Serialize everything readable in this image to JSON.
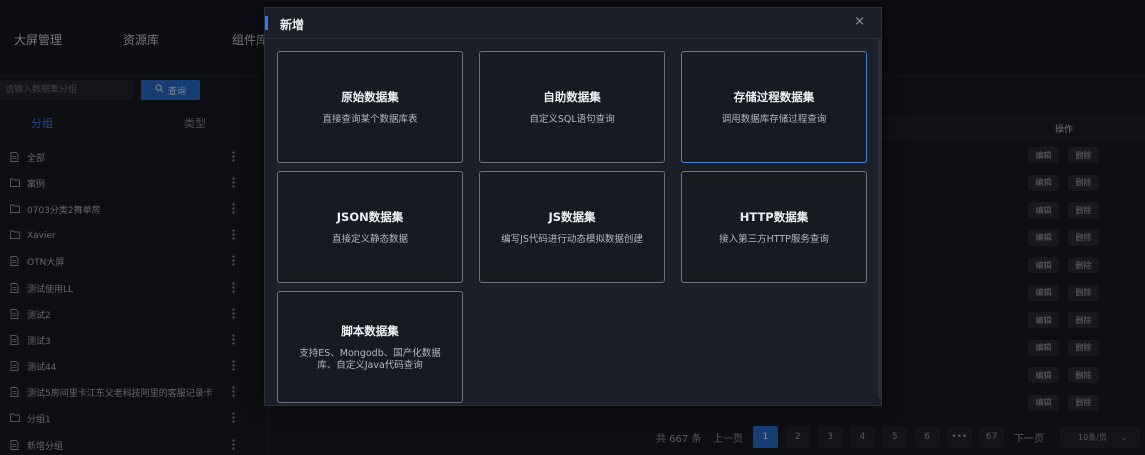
{
  "nav": [
    "大屏管理",
    "资源库",
    "组件库"
  ],
  "search": {
    "placeholder": "请输入数据集分组",
    "button": "查询"
  },
  "tabs": {
    "group": "分组",
    "type": "类型"
  },
  "tree": [
    {
      "label": "全部",
      "icon": "file-icon"
    },
    {
      "label": "案例",
      "icon": "folder-icon"
    },
    {
      "label": "0703分类2舞单房",
      "icon": "folder-icon"
    },
    {
      "label": "Xavier",
      "icon": "folder-icon"
    },
    {
      "label": "OTN大屏",
      "icon": "file-icon"
    },
    {
      "label": "测试使用LL",
      "icon": "file-icon"
    },
    {
      "label": "测试2",
      "icon": "file-icon"
    },
    {
      "label": "测试3",
      "icon": "file-icon"
    },
    {
      "label": "测试44",
      "icon": "file-icon"
    },
    {
      "label": "测试5房间里卡江东父老科技阿里的客服记录卡",
      "icon": "file-icon"
    },
    {
      "label": "分组1",
      "icon": "folder-icon"
    },
    {
      "label": "新增分组",
      "icon": "file-icon"
    }
  ],
  "table": {
    "op_header": "操作",
    "edit": "编辑",
    "delete": "删除",
    "row_count": 10
  },
  "pager": {
    "total": "共 667 条",
    "prev": "上一页",
    "next": "下一页",
    "pages": [
      "1",
      "2",
      "3",
      "4",
      "5",
      "6",
      "•••",
      "67"
    ],
    "current": "1",
    "page_size": "10条/页"
  },
  "modal": {
    "title": "新增",
    "close": "×",
    "cards": [
      {
        "title": "原始数据集",
        "desc": "直接查询某个数据库表"
      },
      {
        "title": "自助数据集",
        "desc": "自定义SQL语句查询"
      },
      {
        "title": "存储过程数据集",
        "desc": "调用数据库存储过程查询"
      },
      {
        "title": "JSON数据集",
        "desc": "直接定义静态数据"
      },
      {
        "title": "JS数据集",
        "desc": "编写JS代码进行动态模拟数据创建"
      },
      {
        "title": "HTTP数据集",
        "desc": "接入第三方HTTP服务查询"
      },
      {
        "title": "脚本数据集",
        "desc": "支持ES、Mongodb、国产化数据库、自定义Java代码查询"
      }
    ]
  }
}
